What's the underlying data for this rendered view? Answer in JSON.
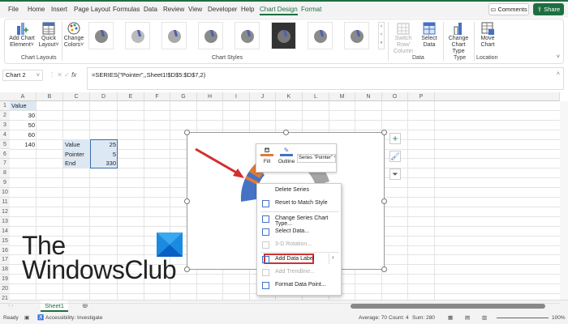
{
  "menu": {
    "tabs": [
      "File",
      "Home",
      "Insert",
      "Page Layout",
      "Formulas",
      "Data",
      "Review",
      "View",
      "Developer",
      "Help",
      "Chart Design",
      "Format"
    ],
    "comments": "Comments",
    "share": "Share"
  },
  "ribbon": {
    "add_chart_element": [
      "Add Chart",
      "Element"
    ],
    "quick_layout": [
      "Quick",
      "Layout"
    ],
    "change_colors": [
      "Change",
      "Colors"
    ],
    "switch_row_column": [
      "Switch Row/",
      "Column"
    ],
    "select_data": [
      "Select",
      "Data"
    ],
    "change_chart_type": [
      "Change",
      "Chart Type"
    ],
    "move_chart": [
      "Move",
      "Chart"
    ],
    "groups": {
      "layouts": "Chart Layouts",
      "styles": "Chart Styles",
      "data": "Data",
      "type": "Type",
      "location": "Location"
    }
  },
  "formula_bar": {
    "name_box": "Chart 2",
    "formula": "=SERIES(\"Pointer\",,Sheet1!$D$5:$D$7,2)",
    "fx": "fx"
  },
  "columns": [
    "A",
    "B",
    "C",
    "D",
    "E",
    "F",
    "G",
    "H",
    "I",
    "J",
    "K",
    "L",
    "M",
    "N",
    "O",
    "P"
  ],
  "rows": [
    "1",
    "2",
    "3",
    "4",
    "5",
    "6",
    "7",
    "8",
    "9",
    "10",
    "11",
    "12",
    "13",
    "14",
    "15",
    "16",
    "17",
    "18",
    "19",
    "20",
    "21"
  ],
  "cells": {
    "A1": "Value",
    "A2": "30",
    "A3": "50",
    "A4": "60",
    "A5": "140",
    "C5": "Value",
    "C6": "Pointer",
    "C7": "End",
    "D5": "25",
    "D6": "5",
    "D7": "330"
  },
  "mini_toolbar": {
    "fill": "Fill",
    "outline": "Outline",
    "series_select": "Series \"Pointer\""
  },
  "context_menu": [
    {
      "label": "Delete Series",
      "disabled": false
    },
    {
      "label": "Reset to Match Style",
      "disabled": false
    },
    {
      "label": "Change Series Chart Type...",
      "disabled": false
    },
    {
      "label": "Select Data...",
      "disabled": false
    },
    {
      "label": "3-D Rotation...",
      "disabled": true
    },
    {
      "label": "Add Data Label",
      "disabled": false,
      "highlighted": true
    },
    {
      "label": "Add Trendline...",
      "disabled": true
    },
    {
      "label": "Format Data Point...",
      "disabled": false
    }
  ],
  "watermark": {
    "line1": "The",
    "line2": "WindowsClub"
  },
  "sheet_tab": "Sheet1",
  "status": {
    "ready": "Ready",
    "accessibility": "Accessibility: Investigate",
    "average": "Average: 70",
    "count": "Count: 4",
    "sum": "Sum: 280",
    "zoom": "100%"
  },
  "colors": {
    "accent": "#1e6e42",
    "pointer": "#e07b39",
    "series": "#4472c4",
    "highlight": "#d32f2f"
  }
}
